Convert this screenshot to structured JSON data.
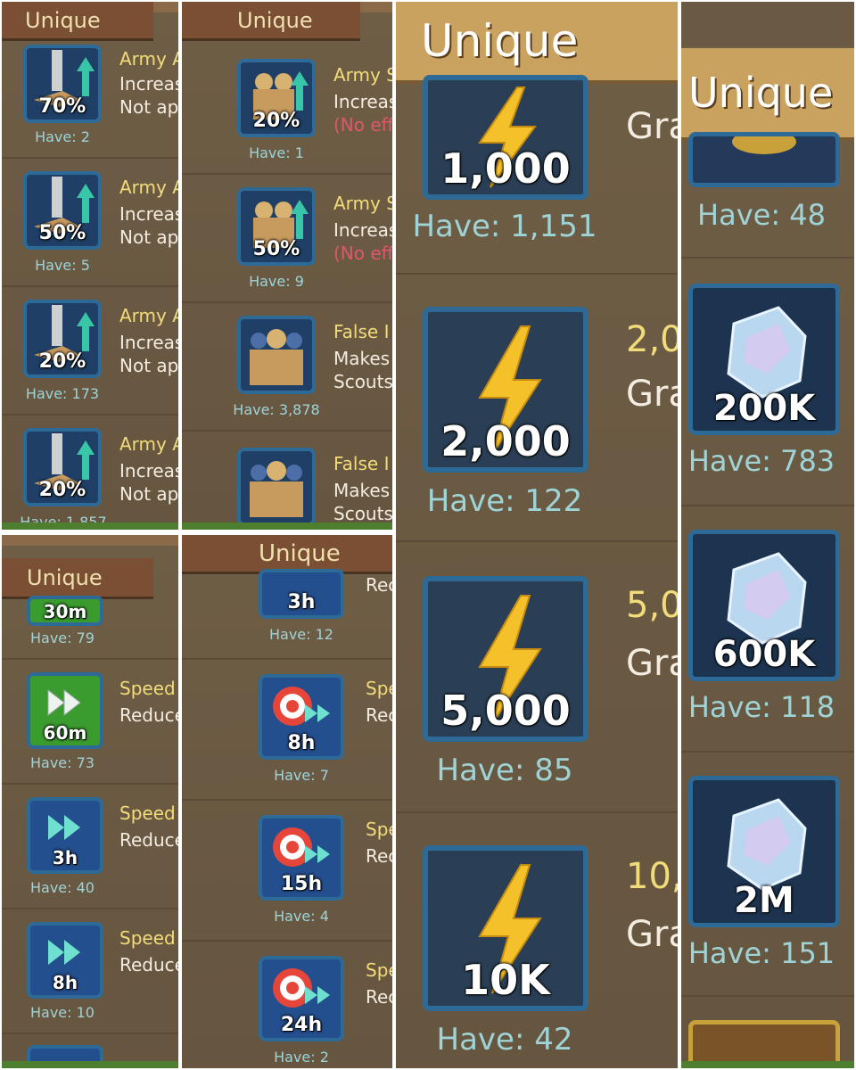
{
  "colors": {
    "accent": "#f2dc7a",
    "have_text": "#9fd3d6",
    "no_effect": "#e0576d",
    "icon_border": "#2e6a97"
  },
  "tab_label": "Unique",
  "panel1": {
    "tab": "Unique",
    "items": [
      {
        "label": "70%",
        "have": "Have: 2",
        "title": "Army A",
        "desc1": "Increas",
        "desc2": "Not ap"
      },
      {
        "label": "50%",
        "have": "Have: 5",
        "title": "Army A",
        "desc1": "Increas",
        "desc2": "Not ap"
      },
      {
        "label": "20%",
        "have": "Have: 173",
        "title": "Army A",
        "desc1": "Increas",
        "desc2": "Not ap"
      },
      {
        "label": "20%",
        "have": "Have: 1,857",
        "title": "Army A",
        "desc1": "Increas",
        "desc2": "Not ap"
      }
    ]
  },
  "panel2": {
    "tab": "Unique",
    "items": [
      {
        "label": "20%",
        "have": "Have: 1",
        "title": "Army S",
        "desc1": "Increas",
        "desc2": "(No eff"
      },
      {
        "label": "50%",
        "have": "Have: 9",
        "title": "Army S",
        "desc1": "Increas",
        "desc2": "(No eff"
      },
      {
        "label": "",
        "have": "Have: 3,878",
        "title": "False I",
        "desc1": "Makes",
        "desc2": "Scouts"
      },
      {
        "label": "",
        "have": "",
        "title": "False I",
        "desc1": "Makes",
        "desc2": "Scouts"
      }
    ]
  },
  "panel3": {
    "tab": "Unique",
    "items": [
      {
        "label": "1,000",
        "have": "Have: 1,151",
        "title": "",
        "desc1": "Gra"
      },
      {
        "label": "2,000",
        "have": "Have: 122",
        "title": "2,0",
        "desc1": "Gra"
      },
      {
        "label": "5,000",
        "have": "Have: 85",
        "title": "5,0",
        "desc1": "Gra"
      },
      {
        "label": "10K",
        "have": "Have: 42",
        "title": "10,",
        "desc1": "Gra"
      }
    ]
  },
  "panel4": {
    "tab": "Unique",
    "items": [
      {
        "label": "",
        "have": "Have: 48"
      },
      {
        "label": "200K",
        "have": "Have: 783"
      },
      {
        "label": "600K",
        "have": "Have: 118"
      },
      {
        "label": "2M",
        "have": "Have: 151"
      }
    ]
  },
  "panel5": {
    "tab": "Unique",
    "items": [
      {
        "label": "30m",
        "have": "Have: 79",
        "title": "",
        "desc1": ""
      },
      {
        "label": "60m",
        "have": "Have: 73",
        "title": "Speed",
        "desc1": "Reduce"
      },
      {
        "label": "3h",
        "have": "Have: 40",
        "title": "Speed",
        "desc1": "Reduce"
      },
      {
        "label": "8h",
        "have": "Have: 10",
        "title": "Speed",
        "desc1": "Reduce"
      }
    ]
  },
  "panel6": {
    "tab": "Unique",
    "items": [
      {
        "label": "3h",
        "have": "Have: 12",
        "title": "",
        "desc1": "Rec"
      },
      {
        "label": "8h",
        "have": "Have: 7",
        "title": "Spe",
        "desc1": "Rec"
      },
      {
        "label": "15h",
        "have": "Have: 4",
        "title": "Spe",
        "desc1": "Rec"
      },
      {
        "label": "24h",
        "have": "Have: 2",
        "title": "Spe",
        "desc1": "Rec"
      }
    ]
  }
}
